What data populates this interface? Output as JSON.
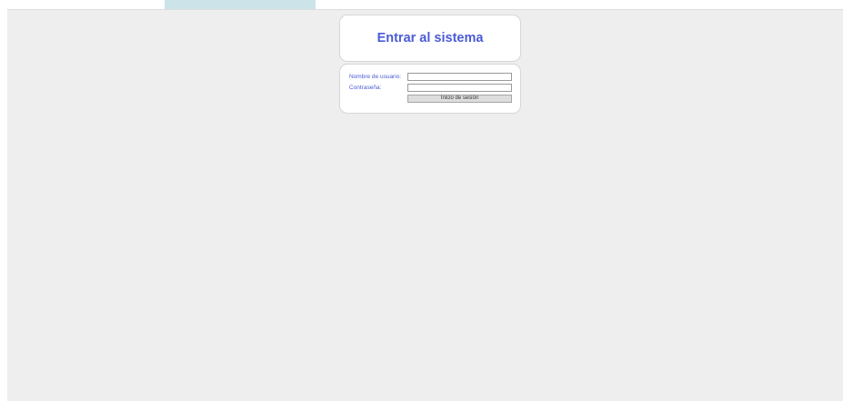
{
  "login": {
    "title": "Entrar al sistema",
    "username_label": "Nombre de usuario:",
    "password_label": "Contraseña:",
    "username_value": "",
    "password_value": "",
    "submit_label": "Inicio de sesión"
  },
  "colors": {
    "accent": "#4a5bd6",
    "background": "#eeeeee",
    "tab": "#cde3ea"
  }
}
